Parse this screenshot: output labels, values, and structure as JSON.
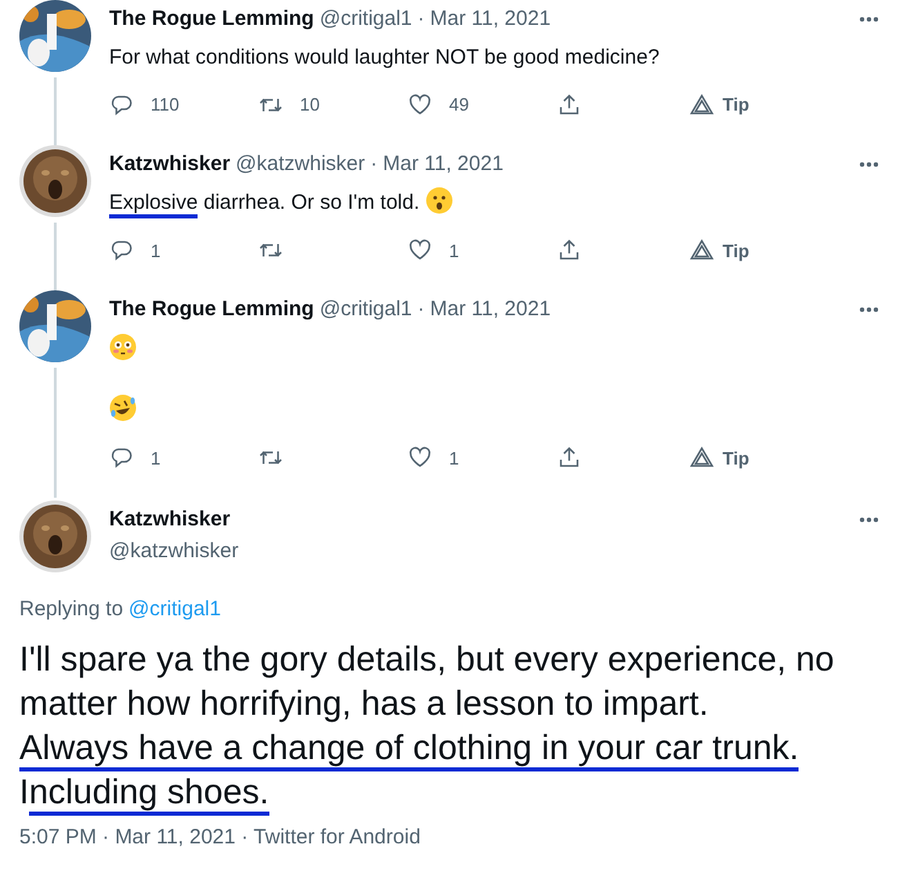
{
  "thread": [
    {
      "name": "The Rogue Lemming",
      "handle": "@critigal1",
      "separator": "·",
      "date": "Mar 11, 2021",
      "paragraphs": [
        [
          {
            "kind": "text",
            "text": "For what conditions would laughter NOT be good medicine?",
            "marked": false
          }
        ]
      ],
      "actions": {
        "replies": "110",
        "retweets": "10",
        "likes": "49",
        "tip": "Tip"
      }
    },
    {
      "name": "Katzwhisker",
      "handle": "@katzwhisker",
      "separator": "·",
      "date": "Mar 11, 2021",
      "paragraphs": [
        [
          {
            "kind": "text",
            "text": "Explosive",
            "marked": true
          },
          {
            "kind": "text",
            "text": " diarrhea. Or so I'm told. ",
            "marked": false
          },
          {
            "kind": "surprised"
          }
        ]
      ],
      "actions": {
        "replies": "1",
        "likes": "1",
        "tip": "Tip"
      }
    },
    {
      "name": "The Rogue Lemming",
      "handle": "@critigal1",
      "separator": "·",
      "date": "Mar 11, 2021",
      "paragraphs": [
        [
          {
            "kind": "flushed"
          }
        ],
        [
          {
            "kind": "laughing"
          }
        ]
      ],
      "actions": {
        "replies": "1",
        "likes": "1",
        "tip": "Tip"
      }
    }
  ],
  "main": {
    "name": "Katzwhisker",
    "handle": "@katzwhisker",
    "replying_prefix": "Replying to",
    "replying_to": "@critigal1",
    "lines": [
      [
        {
          "text": "I'll spare ya the gory details, but every experience, no",
          "marked": false
        }
      ],
      [
        {
          "text": "matter how horrifying, has a lesson to impart.",
          "marked": false
        }
      ],
      [
        {
          "text": "Always have a change of clothing in your car trunk.",
          "marked": true
        }
      ],
      [
        {
          "text": "I",
          "marked": false
        },
        {
          "text": "ncluding shoes.",
          "marked": true
        }
      ]
    ],
    "meta": "5:07 PM · Mar 11, 2021 · Twitter for Android"
  }
}
